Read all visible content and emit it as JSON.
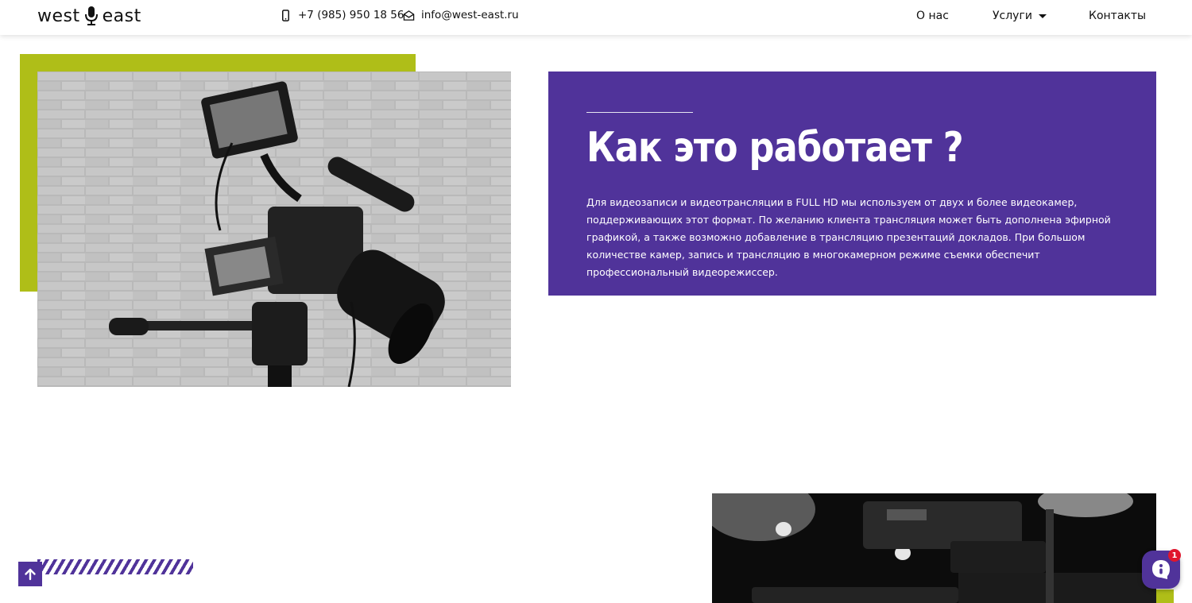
{
  "header": {
    "logo_left": "west",
    "logo_right": "east",
    "phone": "+7 (985) 950 18 56",
    "email": "info@west-east.ru",
    "nav": {
      "about": "О нас",
      "services": "Услуги",
      "contacts": "Контакты"
    }
  },
  "how_it_works": {
    "title": "Как это работает ?",
    "text": "Для видеозаписи и видеотрансляции в FULL HD мы используем от двух и более видеокамер, поддерживающих этот формат. По желанию клиента трансляция может быть дополнена эфирной графикой, а также возможно добавление в трансляцию презентаций докладов. При большом количестве камер,  запись и трансляцию в многокамерном режиме съемки обеспечит профессиональный видеорежиссер."
  },
  "chat": {
    "badge_count": "1"
  },
  "colors": {
    "accent_purple": "#50339a",
    "accent_green": "#afbe18",
    "badge_red": "#e0152d"
  },
  "icons": {
    "phone": "phone-icon",
    "mail": "envelope-icon",
    "scroll_top": "arrow-up-icon",
    "chat": "chat-icon",
    "services_caret": "caret-down-icon"
  }
}
